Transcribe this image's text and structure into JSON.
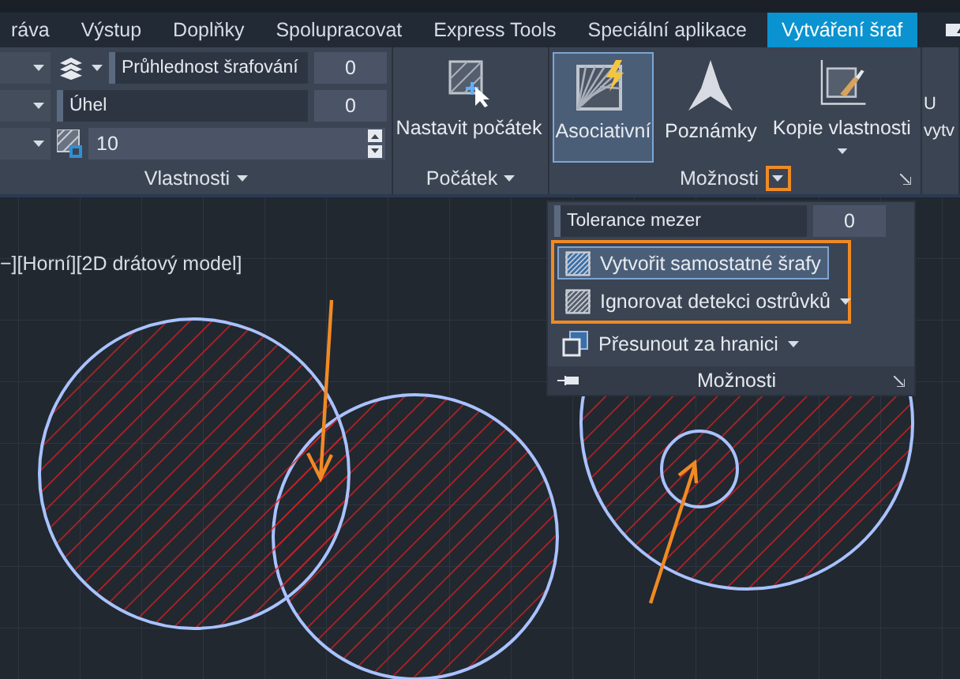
{
  "tabs": [
    {
      "label": "ráva",
      "selected": false
    },
    {
      "label": "Výstup",
      "selected": false
    },
    {
      "label": "Doplňky",
      "selected": false
    },
    {
      "label": "Spolupracovat",
      "selected": false
    },
    {
      "label": "Express Tools",
      "selected": false
    },
    {
      "label": "Speciální aplikace",
      "selected": false
    },
    {
      "label": "Vytváření šraf",
      "selected": true
    }
  ],
  "ribbon": {
    "properties": {
      "title": "Vlastnosti",
      "transparency": {
        "label": "Průhlednost šrafování",
        "value": "0"
      },
      "angle": {
        "label": "Úhel",
        "value": "0"
      },
      "scale": {
        "value": "10"
      }
    },
    "origin": {
      "title": "Počátek",
      "button": "Nastavit počátek"
    },
    "options": {
      "title": "Možnosti",
      "expand_highlighted": true,
      "buttons": [
        {
          "label": "Asociativní",
          "selected": true,
          "has_menu": false,
          "kind": "associative"
        },
        {
          "label": "Poznámky",
          "selected": false,
          "has_menu": false,
          "kind": "annotative"
        },
        {
          "label": "Kopie vlastnosti",
          "selected": false,
          "has_menu": true,
          "kind": "match"
        }
      ]
    },
    "edge_button": {
      "lines": [
        "U",
        "vytv"
      ]
    }
  },
  "options_dropdown": {
    "gap_tolerance": {
      "label": "Tolerance mezer",
      "value": "0"
    },
    "items": [
      {
        "label": "Vytvořit samostatné šrafy",
        "selected": true,
        "highlighted": true,
        "has_menu": false,
        "kind": "separate"
      },
      {
        "label": "Ignorovat detekci ostrůvků",
        "selected": false,
        "highlighted": true,
        "has_menu": true,
        "kind": "island"
      },
      {
        "label": "Přesunout za hranici",
        "selected": false,
        "highlighted": false,
        "has_menu": true,
        "kind": "order"
      }
    ],
    "footer": "Možnosti"
  },
  "viewport": {
    "label": "−][Horní][2D drátový model]"
  }
}
